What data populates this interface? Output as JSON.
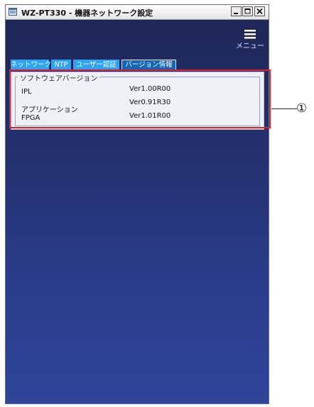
{
  "window": {
    "title": "WZ-PT330 - 機器ネットワーク設定",
    "icon": "app-window-icon",
    "controls": {
      "minimize": "minimize-icon",
      "maximize": "maximize-icon",
      "close": "close-icon"
    }
  },
  "menu": {
    "label": "メニュー",
    "icon": "hamburger-menu-icon"
  },
  "tabs": [
    {
      "label": "ネットワーク",
      "active": false
    },
    {
      "label": "NTP",
      "active": false
    },
    {
      "label": "ユーザー認証",
      "active": false
    },
    {
      "label": "バージョン情報",
      "active": true
    }
  ],
  "version_group": {
    "title": "ソフトウェアバージョン",
    "rows": [
      {
        "label": "IPL",
        "value": "Ver1.00R00"
      },
      {
        "label": "アプリケーション",
        "value": "Ver0.91R30"
      },
      {
        "label": "FPGA",
        "value": "Ver1.01R00"
      }
    ]
  },
  "callout": {
    "label": "①"
  },
  "colors": {
    "background_top": "#1f2758",
    "background_bottom": "#2e459a",
    "tab": "#2fa3f0",
    "tab_active": "#1565b5",
    "highlight": "#e3202d"
  }
}
